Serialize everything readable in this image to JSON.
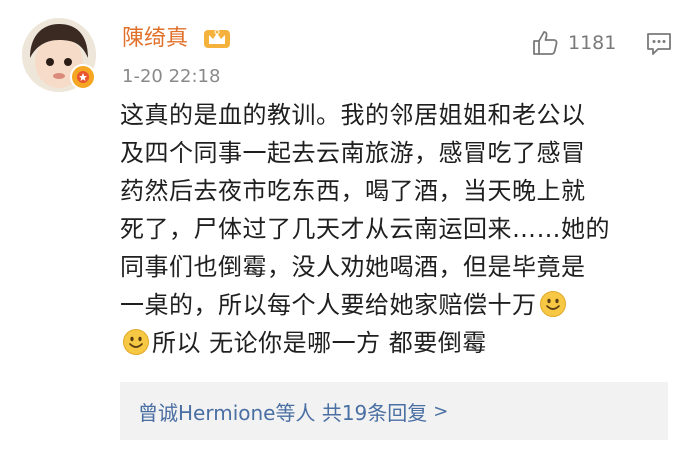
{
  "comment": {
    "author": "陳绮真",
    "timestamp": "1-20 22:18",
    "like_count": "1181",
    "text_lines": [
      "这真的是血的教训。我的邻居姐姐和老公以",
      "及四个同事一起去云南旅游，感冒吃了感冒",
      "药然后去夜市吃东西，喝了酒，当天晚上就",
      "死了，尸体过了几天才从云南运回来……她的",
      "同事们也倒霉，没人劝她喝酒，但是毕竟是",
      "一桌的，所以每个人要给她家赔偿十万",
      "所以 无论你是哪一方 都要倒霉"
    ],
    "replies_label": "曾诚Hermione等人 共19条回复",
    "replies_arrow": ">"
  },
  "icons": {
    "vip": "crown-vip-icon",
    "like": "thumbs-up-icon",
    "comment": "comment-bubble-icon",
    "emoji": "smiley-emoji-icon",
    "badge": "verified-badge-icon"
  },
  "colors": {
    "author": "#e0702a",
    "reply_link": "#4a6fa3",
    "reply_bg": "#f2f2f2",
    "meta": "#8a8a8a",
    "emoji": "#f7c843"
  }
}
